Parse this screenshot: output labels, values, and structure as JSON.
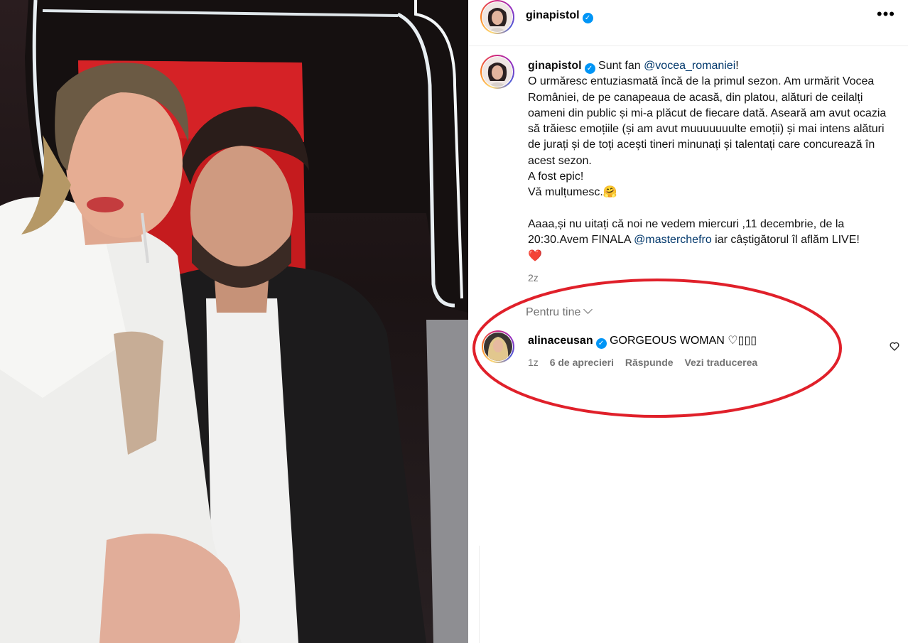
{
  "header": {
    "username": "ginapistol",
    "verified_glyph": "✓",
    "more_glyph": "•••"
  },
  "caption": {
    "username": "ginapistol",
    "intro": "Sunt fan ",
    "mention1": "@vocea_romaniei",
    "intro_end": "!",
    "para1": "O urmăresc entuziasmată încă de la primul sezon. Am urmărit Vocea României, de pe canapeaua de acasă, din platou, alături de ceilalți oameni din public și mi-a plăcut de fiecare dată. Aseară am avut ocazia să trăiesc emoțiile (și am avut muuuuuuulte emoții) și mai intens alături de jurați și de toți acești tineri minunați și talentați care concurează în acest sezon.",
    "line_epic": "A fost epic!",
    "line_thanks": "Vă mulțumesc.",
    "thanks_emoji": "🤗",
    "para2_start": "Aaaa,și nu uitați că noi ne vedem miercuri ,11 decembrie, de la 20:30.Avem FINALA ",
    "mention2": "@masterchefro",
    "para2_end": " iar câștigătorul îl aflăm LIVE!",
    "heart": "❤️",
    "time": "2z"
  },
  "filter": {
    "label": "Pentru tine"
  },
  "comment": {
    "username": "alinaceusan",
    "text": "GORGEOUS WOMAN ",
    "heart": "♡",
    "trailing": "▯▯▯",
    "time": "1z",
    "likes": "6 de aprecieri",
    "reply": "Răspunde",
    "translate": "Vezi traducerea"
  },
  "colors": {
    "verified": "#0095f6",
    "mention": "#00376b",
    "annotation": "#e0202a",
    "muted": "#737373"
  },
  "icons": [
    "more-options-icon",
    "verified-badge-icon",
    "chevron-down-icon",
    "like-heart-icon"
  ]
}
